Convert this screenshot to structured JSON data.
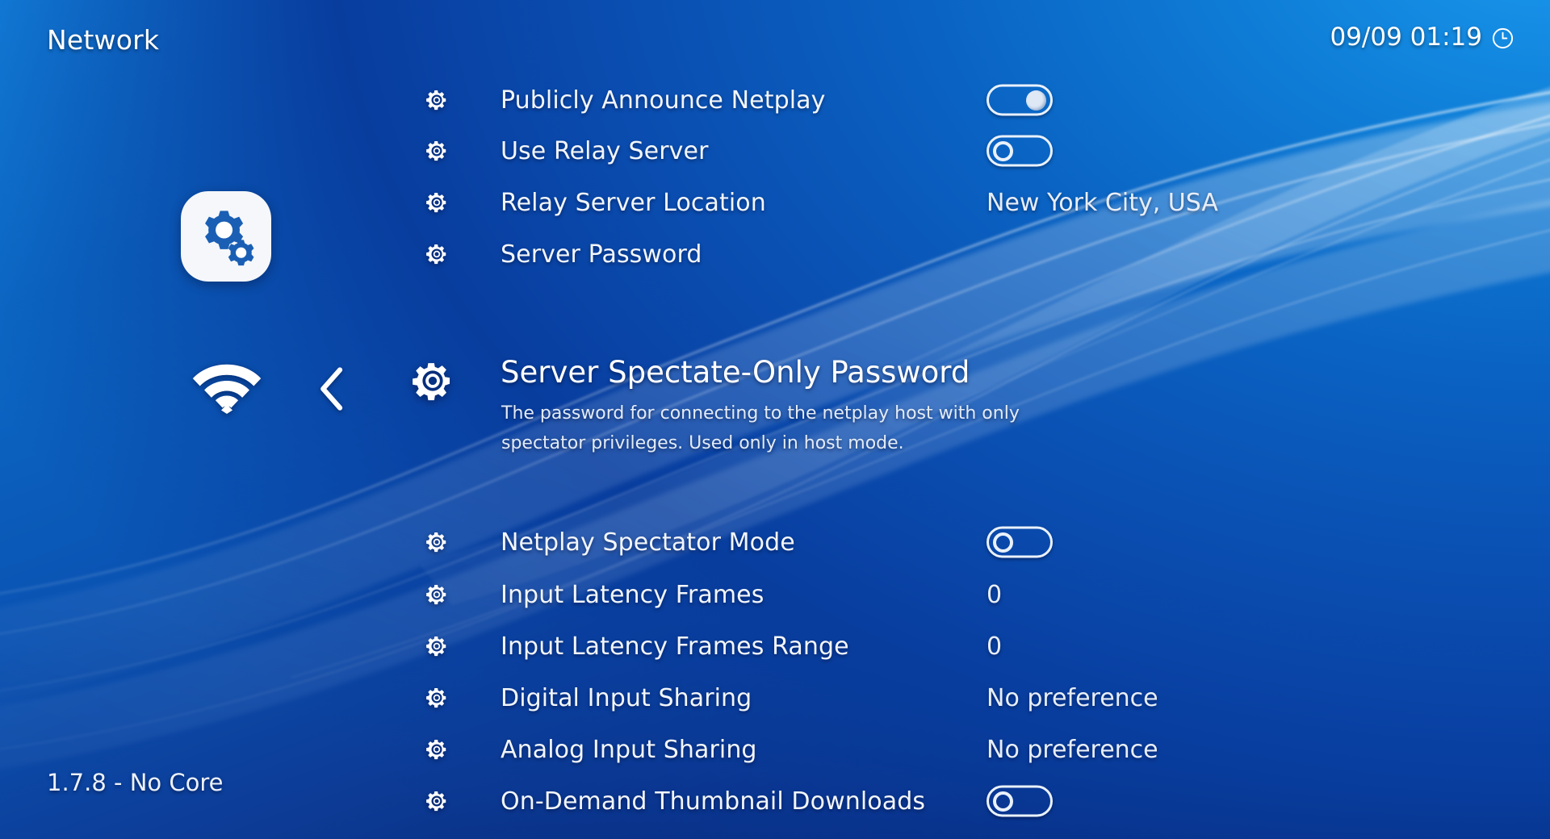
{
  "header": {
    "title": "Network",
    "clock": "09/09 01:19",
    "clock_icon": "clock-icon"
  },
  "sidebar": {
    "category_icon": "settings-gears-icon",
    "tab_icon": "wifi-icon",
    "back_icon": "chevron-left-icon"
  },
  "colors": {
    "background_top_right": "#1490e8",
    "background_bottom_left": "#061152",
    "accent_gear_blue": "#1a5fb4",
    "text_primary": "#ffffff",
    "text_secondary": "#e3ecf8"
  },
  "menu": {
    "items_above": [
      {
        "icon": "gear-icon",
        "label": "Publicly Announce Netplay",
        "control": "toggle",
        "toggle_state": "on",
        "value": ""
      },
      {
        "icon": "gear-icon",
        "label": "Use Relay Server",
        "control": "toggle",
        "toggle_state": "off",
        "value": ""
      },
      {
        "icon": "gear-icon",
        "label": "Relay Server Location",
        "control": "text",
        "toggle_state": "",
        "value": "New York City, USA"
      },
      {
        "icon": "gear-icon",
        "label": "Server Password",
        "control": "none",
        "toggle_state": "",
        "value": ""
      }
    ],
    "selected": {
      "icon": "gear-icon",
      "label": "Server Spectate-Only Password",
      "sublabel": "The password for connecting to the netplay host with only spectator privileges. Used only in host mode.",
      "control": "none",
      "value": ""
    },
    "items_below": [
      {
        "icon": "gear-icon",
        "label": "Netplay Spectator Mode",
        "control": "toggle",
        "toggle_state": "off",
        "value": ""
      },
      {
        "icon": "gear-icon",
        "label": "Input Latency Frames",
        "control": "text",
        "toggle_state": "",
        "value": "0"
      },
      {
        "icon": "gear-icon",
        "label": "Input Latency Frames Range",
        "control": "text",
        "toggle_state": "",
        "value": "0"
      },
      {
        "icon": "gear-icon",
        "label": "Digital Input Sharing",
        "control": "text",
        "toggle_state": "",
        "value": "No preference"
      },
      {
        "icon": "gear-icon",
        "label": "Analog Input Sharing",
        "control": "text",
        "toggle_state": "",
        "value": "No preference"
      },
      {
        "icon": "gear-icon",
        "label": "On-Demand Thumbnail Downloads",
        "control": "toggle",
        "toggle_state": "off",
        "value": ""
      }
    ]
  },
  "footer": {
    "version": "1.7.8 - No Core"
  }
}
